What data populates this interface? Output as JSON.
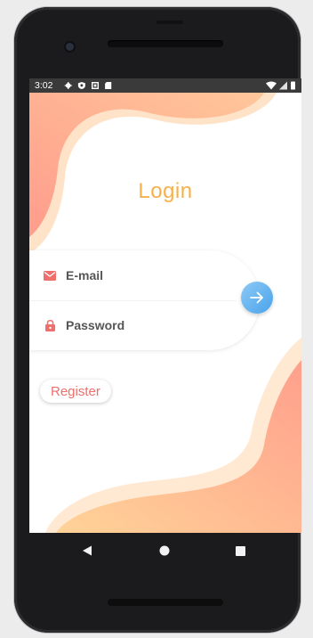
{
  "status_bar": {
    "time": "3:02",
    "left_icons": [
      "gear-icon",
      "shield-icon",
      "square-icon",
      "sd-card-icon"
    ],
    "right_icons": [
      "wifi-icon",
      "signal-icon",
      "battery-icon"
    ]
  },
  "login": {
    "title": "Login",
    "email": {
      "placeholder": "E-mail",
      "value": "",
      "icon": "mail-icon"
    },
    "password": {
      "placeholder": "Password",
      "value": "",
      "icon": "lock-icon"
    },
    "submit_icon": "arrow-right-icon",
    "register_label": "Register"
  },
  "nav": {
    "icons": [
      "back-triangle-icon",
      "home-circle-icon",
      "recents-square-icon"
    ]
  },
  "colors": {
    "title": "#f6b04a",
    "accent_red": "#ef6f6c",
    "submit_blue": "#4aa3ec",
    "wave_pink": "#ffa88e",
    "wave_peach": "#ffd59a"
  }
}
